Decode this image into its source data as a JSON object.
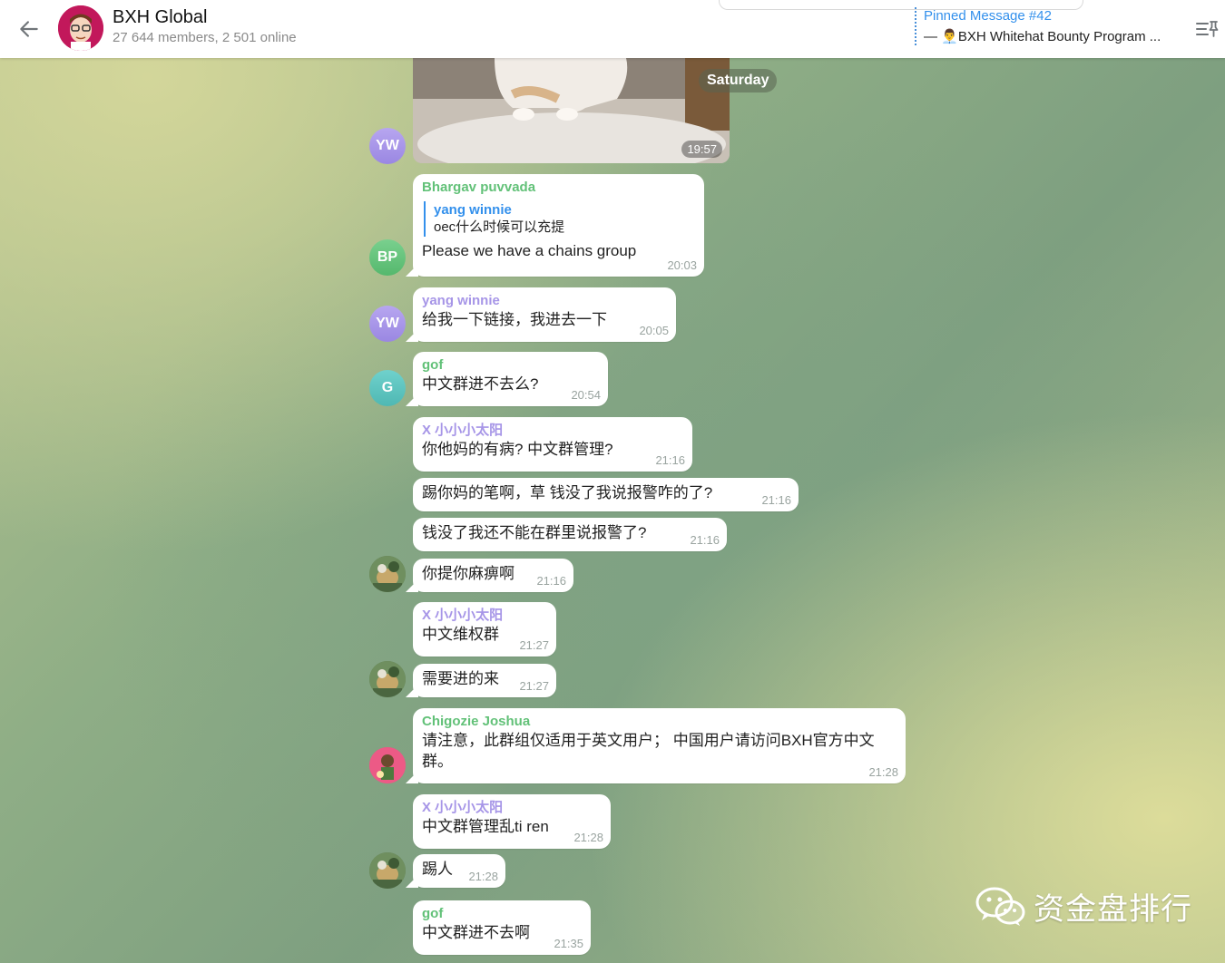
{
  "header": {
    "title": "BXH Global",
    "subtitle": "27 644 members, 2 501 online",
    "pinned_title": "Pinned Message #42",
    "pinned_text": "— 👨‍💼BXH Whitehat Bounty Program ..."
  },
  "date_label": "Saturday",
  "media": {
    "time": "19:57"
  },
  "avatars": {
    "yw": "YW",
    "bp": "BP",
    "g": "G"
  },
  "messages": [
    {
      "sender": "Bhargav puvvada",
      "sender_color": "#62c178",
      "reply_name": "yang winnie",
      "reply_text": "oec什么时候可以充提",
      "text": "Please we have a chains group",
      "time": "20:03"
    },
    {
      "sender": "yang winnie",
      "sender_color": "#a695e7",
      "text": "给我一下链接，我进去一下",
      "time": "20:05"
    },
    {
      "sender": "gof",
      "sender_color": "#62c178",
      "text": "中文群进不去么?",
      "time": "20:54"
    },
    {
      "sender": "X 小小小太阳",
      "sender_color": "#a695e7",
      "text": "你他妈的有病? 中文群管理?",
      "time": "21:16"
    },
    {
      "text": "踢你妈的笔啊，草 钱没了我说报警咋的了?",
      "time": "21:16"
    },
    {
      "text": "钱没了我还不能在群里说报警了?",
      "time": "21:16"
    },
    {
      "text": "你提你麻痹啊",
      "time": "21:16"
    },
    {
      "sender": "X 小小小太阳",
      "sender_color": "#a695e7",
      "text": "中文维权群",
      "time": "21:27"
    },
    {
      "text": "需要进的来",
      "time": "21:27"
    },
    {
      "sender": "Chigozie Joshua",
      "sender_color": "#62c178",
      "text": "请注意，此群组仅适用于英文用户； 中国用户请访问BXH官方中文群。",
      "time": "21:28"
    },
    {
      "sender": "X 小小小太阳",
      "sender_color": "#a695e7",
      "text": "中文群管理乱ti ren",
      "time": "21:28"
    },
    {
      "text": "踢人",
      "time": "21:28"
    },
    {
      "sender": "gof",
      "sender_color": "#62c178",
      "text": "中文群进不去啊",
      "time": "21:35"
    }
  ],
  "watermark": {
    "text": "资金盘排行"
  },
  "colors": {
    "accent": "#3390ec",
    "yw_avatar": "#a695e7",
    "bp_avatar": "#62c178",
    "g_avatar": "#5fc3bf"
  }
}
